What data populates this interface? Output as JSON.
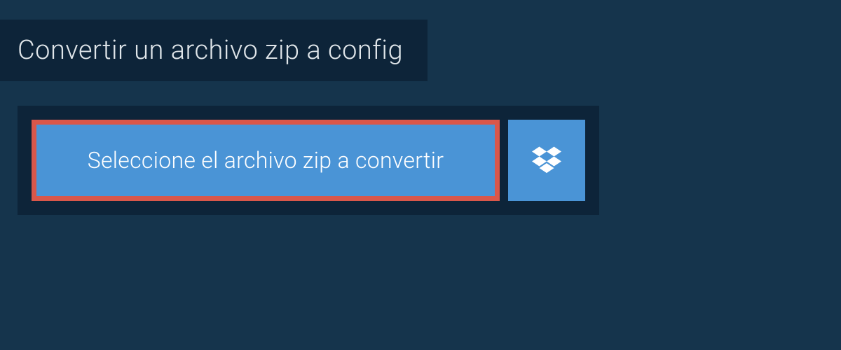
{
  "header": {
    "title": "Convertir un archivo zip a config"
  },
  "main": {
    "select_button_label": "Seleccione el archivo zip a convertir"
  },
  "colors": {
    "page_bg": "#15344c",
    "panel_bg": "#0d2439",
    "button_bg": "#4a94d6",
    "button_highlight_border": "#d9574a",
    "text_light": "#e0e6ea",
    "text_white": "#ffffff"
  },
  "icons": {
    "dropbox": "dropbox-icon"
  }
}
